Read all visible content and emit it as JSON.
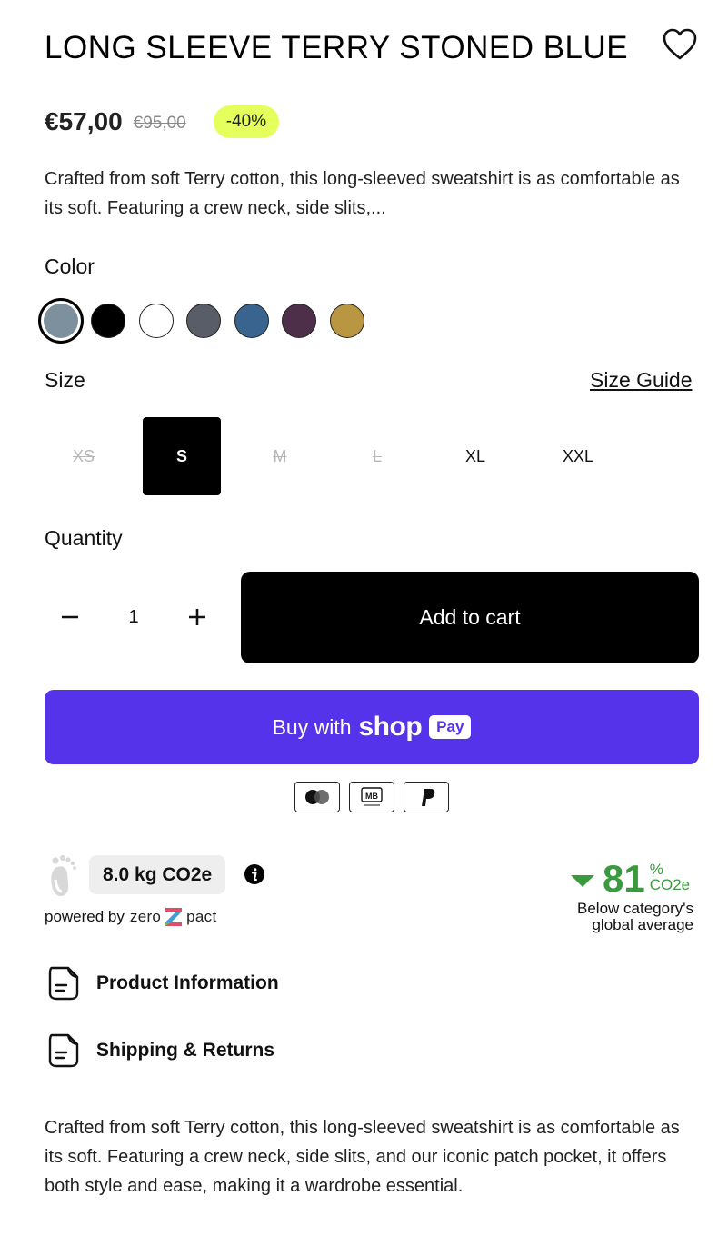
{
  "product": {
    "title": "LONG SLEEVE TERRY STONED BLUE",
    "price": "€57,00",
    "compare_price": "€95,00",
    "discount_badge": "-40%",
    "short_description": "Crafted from soft Terry cotton, this long-sleeved sweatshirt is as comfortable as its soft. Featuring a crew neck, side slits,...",
    "long_description": "Crafted from soft Terry cotton, this long-sleeved sweatshirt is as comfortable as its soft. Featuring a crew neck, side slits, and our iconic patch pocket, it offers both style and ease, making it a wardrobe essential."
  },
  "color": {
    "label": "Color",
    "swatches": [
      {
        "hex": "#7d909e",
        "selected": true
      },
      {
        "hex": "#000000",
        "selected": false
      },
      {
        "hex": "#ffffff",
        "selected": false
      },
      {
        "hex": "#585d68",
        "selected": false
      },
      {
        "hex": "#3a6490",
        "selected": false
      },
      {
        "hex": "#4d2f4a",
        "selected": false
      },
      {
        "hex": "#b99742",
        "selected": false
      }
    ]
  },
  "size": {
    "label": "Size",
    "guide_link": "Size Guide",
    "options": [
      {
        "label": "XS",
        "state": "unavailable"
      },
      {
        "label": "S",
        "state": "selected"
      },
      {
        "label": "M",
        "state": "unavailable"
      },
      {
        "label": "L",
        "state": "unavailable"
      },
      {
        "label": "XL",
        "state": "available"
      },
      {
        "label": "XXL",
        "state": "available"
      }
    ]
  },
  "quantity": {
    "label": "Quantity",
    "value": "1",
    "decrease_icon": "minus-icon",
    "increase_icon": "plus-icon"
  },
  "buttons": {
    "add_to_cart": "Add to cart",
    "buy_with": "Buy with",
    "shop": "shop",
    "pay": "Pay"
  },
  "payment_icons": [
    "mastercard-icon",
    "multibanco-icon",
    "paypal-icon"
  ],
  "payment_icon_text": {
    "multibanco": "MB"
  },
  "carbon": {
    "footprint_value": "8.0 kg CO2e",
    "powered_by": "powered by",
    "brand_left": "zero",
    "brand_right": "pact",
    "reduction_number": "81",
    "reduction_unit_top": "%",
    "reduction_unit_bottom": "CO2e",
    "note_line1": "Below category's",
    "note_line2": "global average",
    "accent_color": "#3a9a3e"
  },
  "accordions": [
    {
      "label": "Product Information",
      "icon": "document-icon"
    },
    {
      "label": "Shipping & Returns",
      "icon": "document-icon"
    }
  ],
  "colors": {
    "shop_pay": "#5433eb",
    "badge": "#e5ff5c",
    "primary_button": "#000000"
  }
}
